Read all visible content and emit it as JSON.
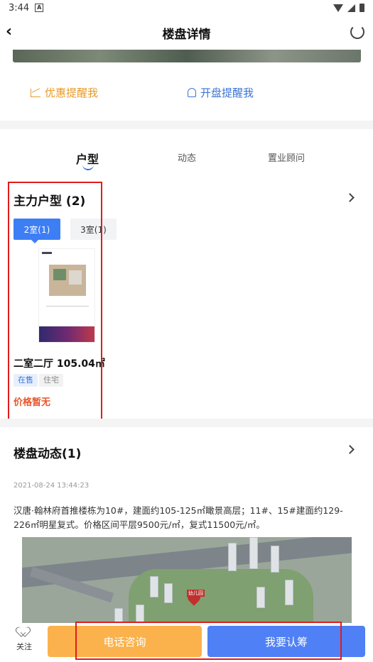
{
  "status_bar": {
    "time": "3:44",
    "notification": "A"
  },
  "header": {
    "title": "楼盘详情"
  },
  "reminders": {
    "discount_label": "优惠提醒我",
    "opening_label": "开盘提醒我"
  },
  "tabs": [
    {
      "label": "户型"
    },
    {
      "label": "动态"
    },
    {
      "label": "置业顾问"
    }
  ],
  "units": {
    "title": "主力户型 (2)",
    "room_tabs": [
      {
        "label": "2室(1)"
      },
      {
        "label": "3室(1)"
      }
    ],
    "card": {
      "name": "二室二厅  105.04㎡",
      "tags": [
        "在售",
        "住宅"
      ],
      "price": "价格暂无"
    }
  },
  "news": {
    "title": "楼盘动态(1)",
    "time": "2021-08-24 13:44:23",
    "text": "汉唐·翰林府首推楼栋为10#，建面约105-125㎡瞰景高层；11#、15#建面约129-226㎡明星复式。价格区间平层9500元/㎡，复式11500元/㎡。",
    "image_label": "幼儿园"
  },
  "bottom_bar": {
    "follow_label": "关注",
    "phone_label": "电话咨询",
    "subscribe_label": "我要认筹"
  },
  "colors": {
    "accent_blue": "#3d7ef5",
    "orange": "#fbb24c",
    "price_red": "#e8562a",
    "highlight_red": "#e01c1c"
  }
}
